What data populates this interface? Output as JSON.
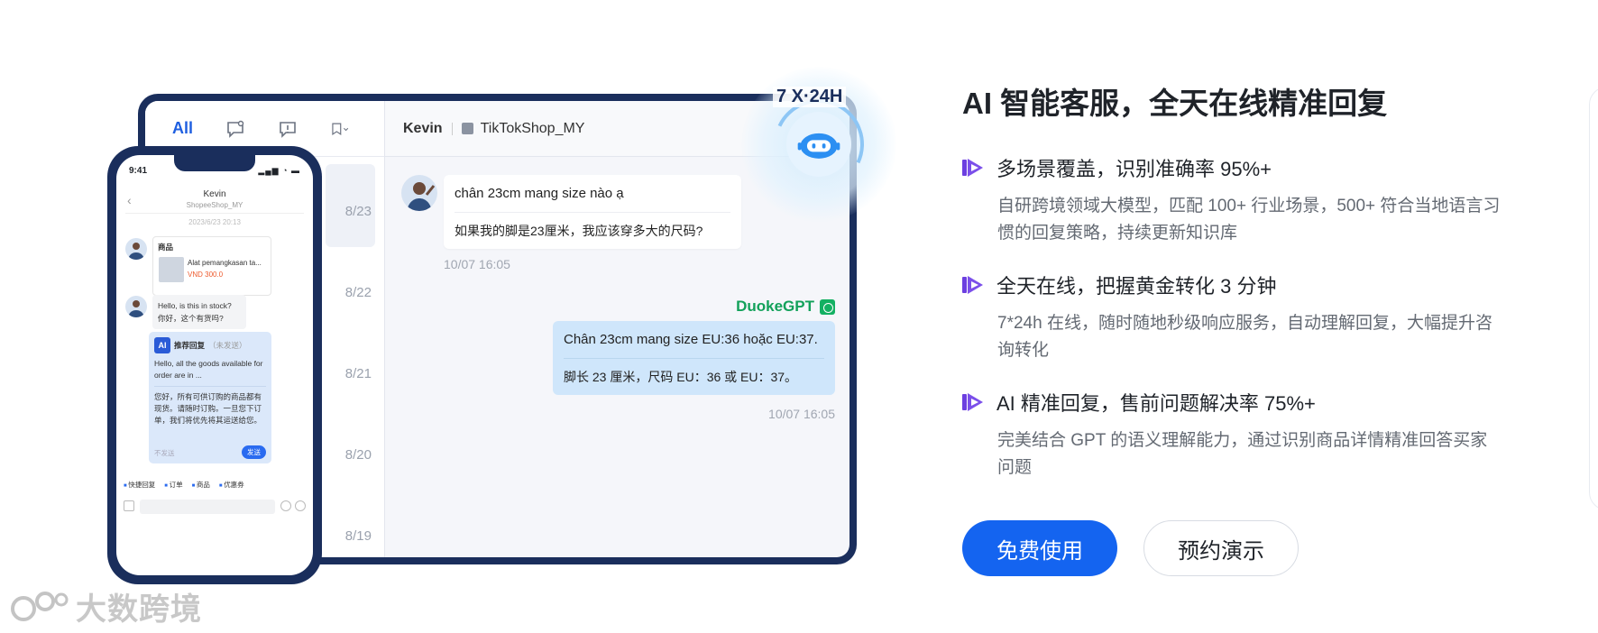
{
  "tablet": {
    "tab_all": "All",
    "dates": [
      "8/23",
      "8/22",
      "8/21",
      "8/20",
      "8/19"
    ],
    "header_name": "Kevin",
    "header_shop": "TikTokShop_MY",
    "incoming_line1": "chân 23cm mang size nào ạ",
    "incoming_line2": "如果我的脚是23厘米，我应该穿多大的尺码?",
    "incoming_time": "10/07 16:05",
    "gpt_label": "DuokeGPT",
    "outgoing_line1": "Chân 23cm mang size EU:36 hoặc EU:37.",
    "outgoing_line2": "脚长 23 厘米，尺码 EU：36 或 EU：37。",
    "outgoing_time": "10/07 16:05",
    "badge": "7 X·24H"
  },
  "phone": {
    "time": "9:41",
    "name": "Kevin",
    "shop": "ShopeeShop_MY",
    "date": "2023/6/23 20:13",
    "card_title": "商品",
    "card_name": "Alat pemangkasan ta...",
    "card_price": "VND 300.0",
    "msg_en": "Hello, is this in stock?",
    "msg_zh": "你好，这个有货吗?",
    "rec_title": "推荐回复",
    "rec_sub": "（未发送）",
    "rec_en": "Hello, all the goods available for order are in ...",
    "rec_zh": "您好，所有可供订购的商品都有现货。请随时订购。一旦您下订单，我们将优先将其运送给您。",
    "rec_nosend": "不发送",
    "rec_send": "发送",
    "toolbar": [
      "快捷回复",
      "订单",
      "商品",
      "优惠券"
    ]
  },
  "watermark": "大数跨境",
  "panel": {
    "title": "AI 智能客服，全天在线精准回复",
    "features": [
      {
        "title": "多场景覆盖，识别准确率 95%+",
        "desc": "自研跨境领域大模型，匹配 100+ 行业场景，500+ 符合当地语言习惯的回复策略，持续更新知识库"
      },
      {
        "title": "全天在线，把握黄金转化 3 分钟",
        "desc": "7*24h 在线，随时随地秒级响应服务，自动理解回复，大幅提升咨询转化"
      },
      {
        "title": "AI 精准回复，售前问题解决率 75%+",
        "desc": "完美结合 GPT 的语义理解能力，通过识别商品详情精准回答买家问题"
      }
    ],
    "primary_button": "免费使用",
    "secondary_button": "预约演示"
  },
  "colors": {
    "accent": "#1464f0",
    "frame": "#1a2e5c",
    "gpt_green": "#12a15a",
    "feature_icon": "#7b3fe4"
  }
}
